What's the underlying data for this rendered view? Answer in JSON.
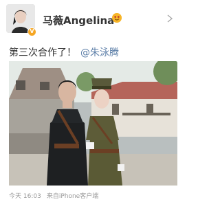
{
  "post": {
    "author": "马薇Angelina",
    "text": "第三次合作了！",
    "mention": "@朱泳腾",
    "time": "今天 16:03",
    "source": "来自iPhone客户端"
  },
  "icons": {
    "avatar": "user-avatar",
    "verified": "verified-badge-icon",
    "emoji": "smiling-face-icon",
    "chevron": "chevron-right-icon"
  },
  "colors": {
    "mention": "#5d7fa8",
    "meta": "#999999",
    "badge": "#f5a623"
  }
}
